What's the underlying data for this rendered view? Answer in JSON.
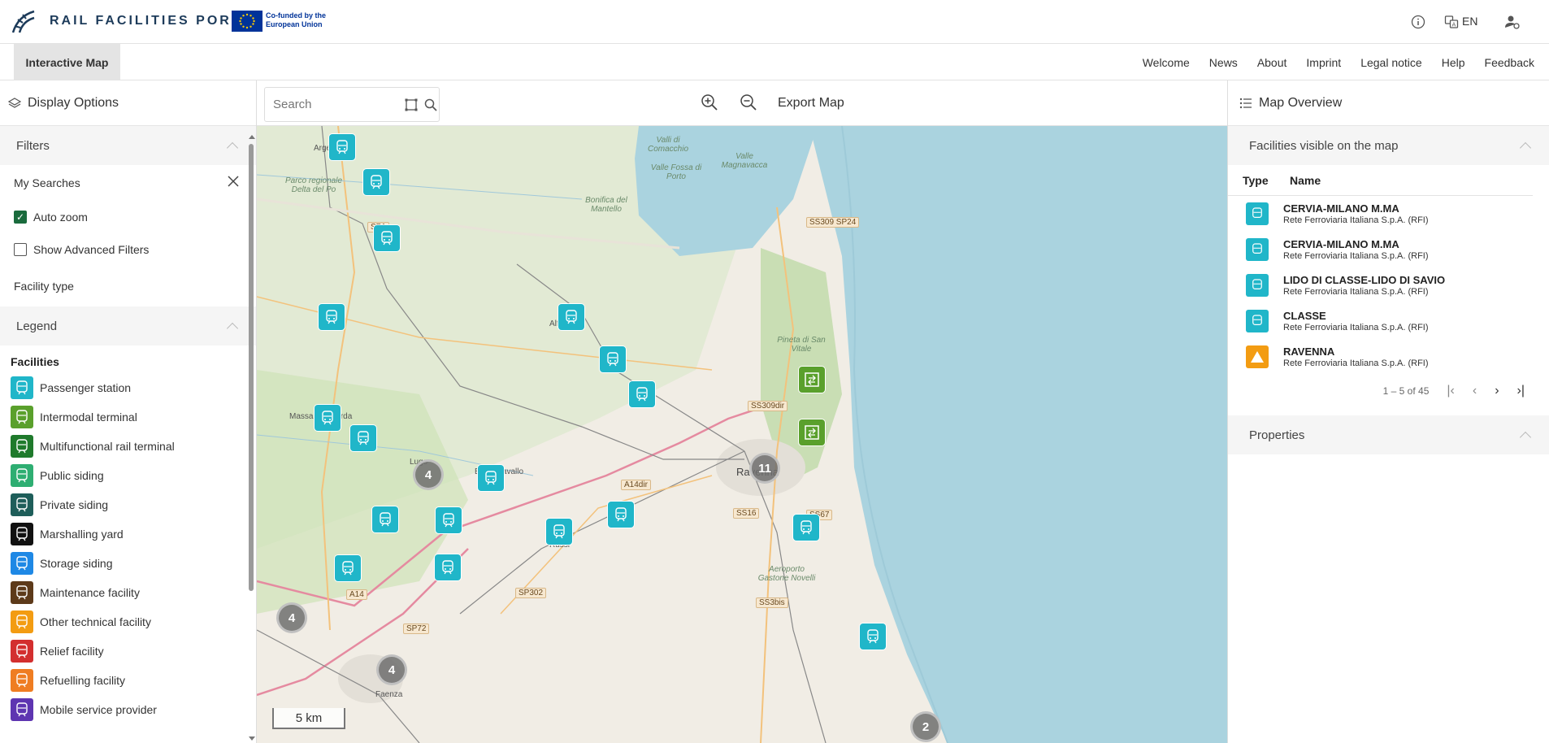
{
  "header": {
    "logo_text": "RAIL FACILITIES PORTAL",
    "eu_text": "Co-funded by the European Union",
    "language": "EN",
    "icons": [
      "info-icon",
      "translate-icon",
      "user-settings-icon"
    ]
  },
  "nav": {
    "active_tab": "Interactive Map",
    "links": [
      "Welcome",
      "News",
      "About",
      "Imprint",
      "Legal notice",
      "Help",
      "Feedback"
    ]
  },
  "left_panel": {
    "title": "Display Options",
    "filters_title": "Filters",
    "my_searches": "My Searches",
    "auto_zoom": "Auto zoom",
    "auto_zoom_checked": true,
    "advanced_filters": "Show Advanced Filters",
    "advanced_filters_checked": false,
    "facility_type": "Facility type",
    "legend_title": "Legend",
    "facilities_heading": "Facilities",
    "legend": [
      {
        "label": "Passenger station",
        "color": "#20b6c9",
        "icon": "passenger-station-icon"
      },
      {
        "label": "Intermodal terminal",
        "color": "#5aa02c",
        "icon": "intermodal-terminal-icon"
      },
      {
        "label": "Multifunctional rail terminal",
        "color": "#1f7a2c",
        "icon": "multifunctional-terminal-icon"
      },
      {
        "label": "Public siding",
        "color": "#2eae72",
        "icon": "public-siding-icon"
      },
      {
        "label": "Private siding",
        "color": "#1e5e5a",
        "icon": "private-siding-icon"
      },
      {
        "label": "Marshalling yard",
        "color": "#111111",
        "icon": "marshalling-yard-icon"
      },
      {
        "label": "Storage siding",
        "color": "#1e88e5",
        "icon": "storage-siding-icon"
      },
      {
        "label": "Maintenance facility",
        "color": "#5d3a1a",
        "icon": "maintenance-facility-icon"
      },
      {
        "label": "Other technical facility",
        "color": "#f39c12",
        "icon": "other-technical-facility-icon"
      },
      {
        "label": "Relief facility",
        "color": "#d32f2f",
        "icon": "relief-facility-icon"
      },
      {
        "label": "Refuelling facility",
        "color": "#ef7d22",
        "icon": "refuelling-facility-icon"
      },
      {
        "label": "Mobile service provider",
        "color": "#5e35b1",
        "icon": "mobile-service-provider-icon"
      }
    ]
  },
  "toolbar": {
    "search_placeholder": "Search",
    "export_label": "Export Map"
  },
  "map": {
    "scale_label": "5 km",
    "clusters": [
      "4",
      "11",
      "4",
      "4",
      "2"
    ],
    "places": [
      "Argenta",
      "Parco regionale Delta del Po",
      "Valli di Comacchio",
      "Valle Fossa di Porto",
      "Valle Magnavacca",
      "Bonifica del Mantello",
      "Alfonsine",
      "Pineta di San Vitale",
      "Massa Lombarda",
      "Lugo",
      "Bagnacavallo",
      "Russi",
      "Ravenna",
      "Aeroporto Gastone Novelli",
      "Faenza"
    ],
    "roads": [
      "SS309 SP24",
      "SP1",
      "SS309dir",
      "A14dir",
      "SS16",
      "A14",
      "SP302",
      "SP72",
      "SS3bis",
      "SS67"
    ]
  },
  "right_panel": {
    "title": "Map Overview",
    "visible_title": "Facilities visible on the map",
    "col_type": "Type",
    "col_name": "Name",
    "facilities": [
      {
        "name": "CERVIA-MILANO M.MA",
        "operator": "Rete Ferroviaria Italiana S.p.A. (RFI)",
        "type": "passenger"
      },
      {
        "name": "CERVIA-MILANO M.MA",
        "operator": "Rete Ferroviaria Italiana S.p.A. (RFI)",
        "type": "passenger"
      },
      {
        "name": "LIDO DI CLASSE-LIDO DI SAVIO",
        "operator": "Rete Ferroviaria Italiana S.p.A. (RFI)",
        "type": "passenger"
      },
      {
        "name": "CLASSE",
        "operator": "Rete Ferroviaria Italiana S.p.A. (RFI)",
        "type": "passenger"
      },
      {
        "name": "RAVENNA",
        "operator": "Rete Ferroviaria Italiana S.p.A. (RFI)",
        "type": "other-technical"
      }
    ],
    "pagination": "1 – 5 of 45",
    "properties_title": "Properties"
  }
}
